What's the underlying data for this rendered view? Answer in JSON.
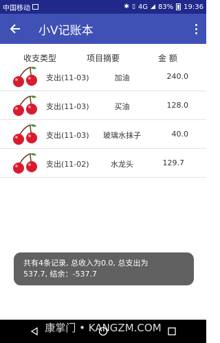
{
  "statusbar": {
    "carrier": "中国移动",
    "network": "4G",
    "battery": "83%",
    "time": "19:36"
  },
  "appbar": {
    "title": "小V记账本"
  },
  "table": {
    "headers": [
      "收支类型",
      "项目摘要",
      "金 额"
    ],
    "rows": [
      {
        "type": "支出(11-03)",
        "desc": "加油",
        "amount": "240.0"
      },
      {
        "type": "支出(11-03)",
        "desc": "买油",
        "amount": "128.0"
      },
      {
        "type": "支出(11-03)",
        "desc": "玻璃水抹子",
        "amount": "40.0"
      },
      {
        "type": "支出(11-02)",
        "desc": "水龙头",
        "amount": "129.7"
      }
    ]
  },
  "toast": {
    "line1": "共有4条记录, 总收入为0.0, 总支出为",
    "line2": "537.7, 结余：-537.7"
  },
  "watermark": "康掌门 • KANGZM.COM",
  "colors": {
    "appbar": "#3f51b5",
    "statusbar": "#20298a",
    "toast": "#616161",
    "cherry": "#d81b2f"
  }
}
